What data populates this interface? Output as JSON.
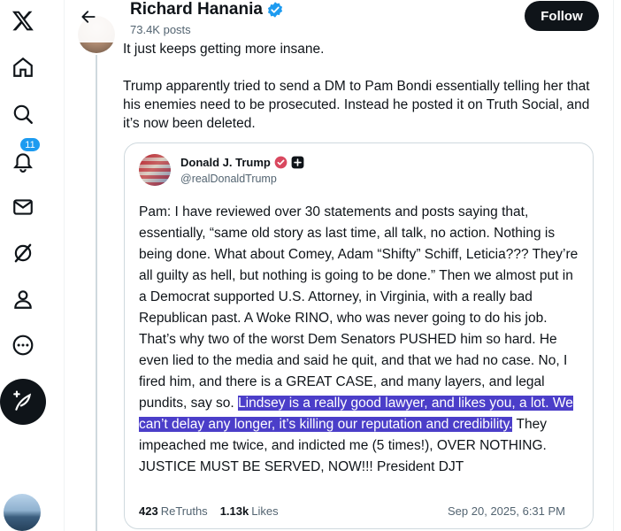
{
  "nav": {
    "notifications_badge": "11"
  },
  "header": {
    "name": "Richard Hanania",
    "posts_count": "73.4K posts",
    "follow_label": "Follow"
  },
  "tweet": {
    "paragraph_1": "It just keeps getting more insane.",
    "paragraph_2": "Trump apparently tried to send a DM to Pam Bondi essentially telling her that his enemies need to be prosecuted. Instead he posted it on Truth Social, and it’s now been deleted."
  },
  "quote": {
    "name": "Donald J. Trump",
    "handle": "@realDonaldTrump",
    "text_before": "Pam: I have reviewed over 30 statements and posts saying that, essentially, “same old story as last time, all talk, no action. Nothing is being done. What about Comey, Adam “Shifty” Schiff, Leticia??? They’re all guilty as hell, but nothing is going to be done.” Then we almost put in a Democrat supported U.S. Attorney, in Virginia, with a really bad Republican past. A Woke RINO, who was never going to do his job. That’s why two of the worst Dem Senators PUSHED him so hard. He even lied to the media and said he quit, and that we had no case. No, I fired him, and there is a GREAT CASE, and many layers, and legal pundits, say so. ",
    "text_highlighted": "Lindsey is a really good lawyer, and likes you, a lot. We can’t delay any longer, it’s killing our reputation and credibility.",
    "text_after": " They impeached me twice, and indicted me (5 times!), OVER NOTHING. JUSTICE MUST BE SERVED, NOW!!! President DJT",
    "retruths_count": "423",
    "retruths_label": "ReTruths",
    "likes_count": "1.13k",
    "likes_label": "Likes",
    "timestamp": "Sep 20, 2025, 6:31 PM"
  },
  "colors": {
    "accent": "#1d9bf0",
    "highlight": "#4b3ec9",
    "text": "#0f1419",
    "muted": "#536471"
  },
  "icons": [
    "x-logo-icon",
    "home-icon",
    "search-icon",
    "notifications-icon",
    "messages-icon",
    "grok-icon",
    "profile-icon",
    "more-icon",
    "compose-icon",
    "back-arrow-icon",
    "verified-icon"
  ]
}
